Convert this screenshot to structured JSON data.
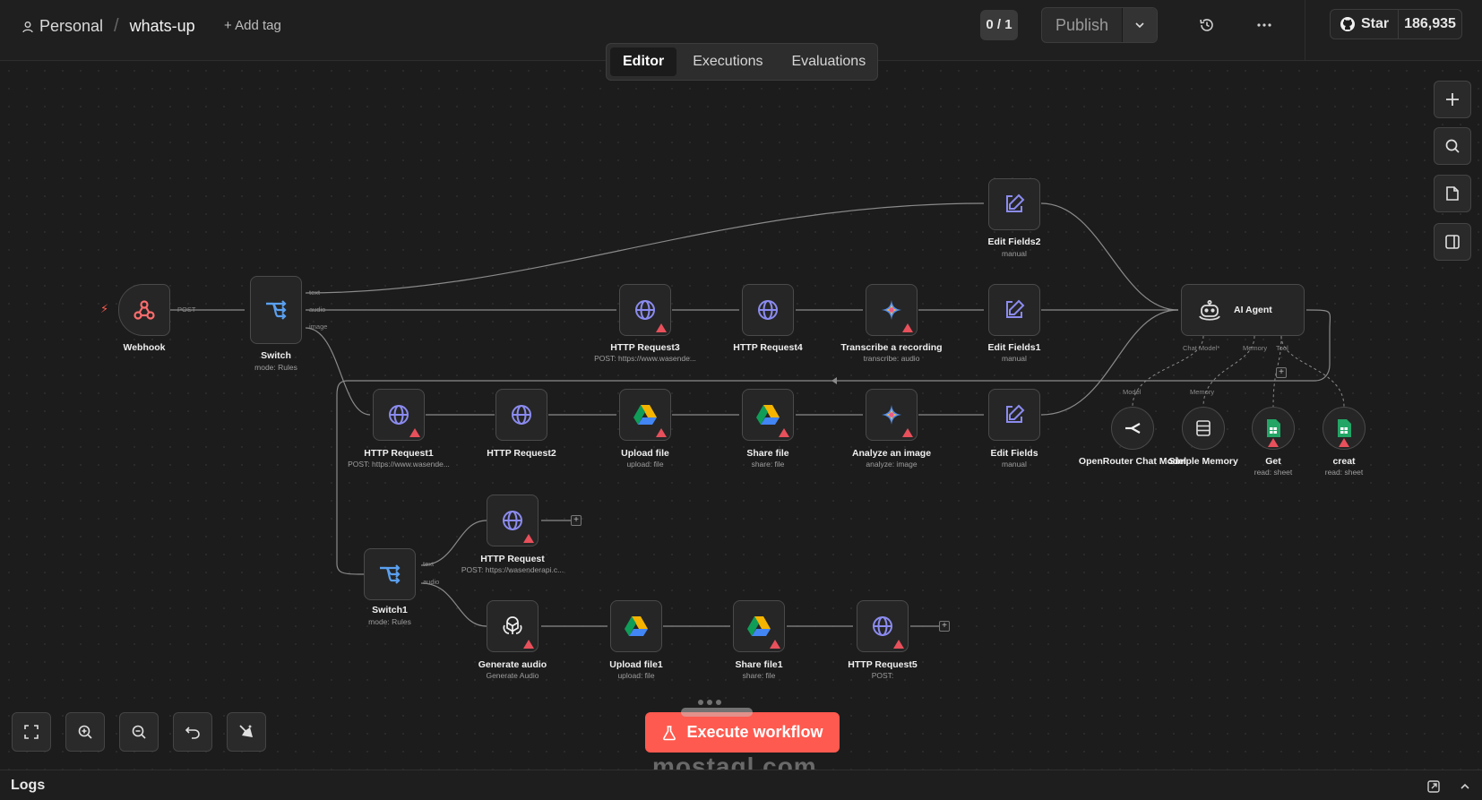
{
  "header": {
    "project": "Personal",
    "workflow_name": "whats-up",
    "add_tag": "+ Add tag",
    "counter": "0 / 1",
    "publish_label": "Publish",
    "star_label": "Star",
    "star_count": "186,935"
  },
  "tabs": [
    {
      "label": "Editor",
      "active": true
    },
    {
      "label": "Executions",
      "active": false
    },
    {
      "label": "Evaluations",
      "active": false
    }
  ],
  "nodes": {
    "webhook": {
      "label": "Webhook"
    },
    "switch": {
      "label": "Switch",
      "sub": "mode: Rules"
    },
    "edit_fields2": {
      "label": "Edit Fields2",
      "sub": "manual"
    },
    "http_request3": {
      "label": "HTTP Request3",
      "sub": "POST: https://www.wasende..."
    },
    "http_request4": {
      "label": "HTTP Request4"
    },
    "transcribe": {
      "label": "Transcribe a recording",
      "sub": "transcribe: audio"
    },
    "edit_fields1": {
      "label": "Edit Fields1",
      "sub": "manual"
    },
    "ai_agent": {
      "label": "AI Agent"
    },
    "http_request1": {
      "label": "HTTP Request1",
      "sub": "POST: https://www.wasende..."
    },
    "http_request2": {
      "label": "HTTP Request2"
    },
    "upload_file": {
      "label": "Upload file",
      "sub": "upload: file"
    },
    "share_file": {
      "label": "Share file",
      "sub": "share: file"
    },
    "analyze_image": {
      "label": "Analyze an image",
      "sub": "analyze: image"
    },
    "edit_fields": {
      "label": "Edit Fields",
      "sub": "manual"
    },
    "openrouter": {
      "label": "OpenRouter Chat Model"
    },
    "simple_memory": {
      "label": "Simple Memory"
    },
    "get": {
      "label": "Get",
      "sub": "read: sheet"
    },
    "creat": {
      "label": "creat",
      "sub": "read: sheet"
    },
    "http_request": {
      "label": "HTTP Request",
      "sub": "POST: https://wasenderapi.c..."
    },
    "switch1": {
      "label": "Switch1",
      "sub": "mode: Rules"
    },
    "generate_audio": {
      "label": "Generate audio",
      "sub": "Generate Audio"
    },
    "upload_file1": {
      "label": "Upload file1",
      "sub": "upload: file"
    },
    "share_file1": {
      "label": "Share file1",
      "sub": "share: file"
    },
    "http_request5": {
      "label": "HTTP Request5",
      "sub": "POST:"
    }
  },
  "edge_labels": {
    "post": "POST",
    "text": "text",
    "audio": "audio",
    "image": "image",
    "chat_model": "Chat Model*",
    "memory": "Memory",
    "tool": "Tool",
    "model": "Model",
    "text2": "text",
    "audio2": "audio"
  },
  "execute_label": "Execute workflow",
  "watermark": "mostaql.com",
  "logs_label": "Logs",
  "colors": {
    "accent": "#ff5a4f",
    "http_icon": "#8b8bf0",
    "switch_icon": "#5aa0f0",
    "edit_icon": "#8b8bf0",
    "warning": "#e8505b",
    "sheets": "#22a565"
  }
}
